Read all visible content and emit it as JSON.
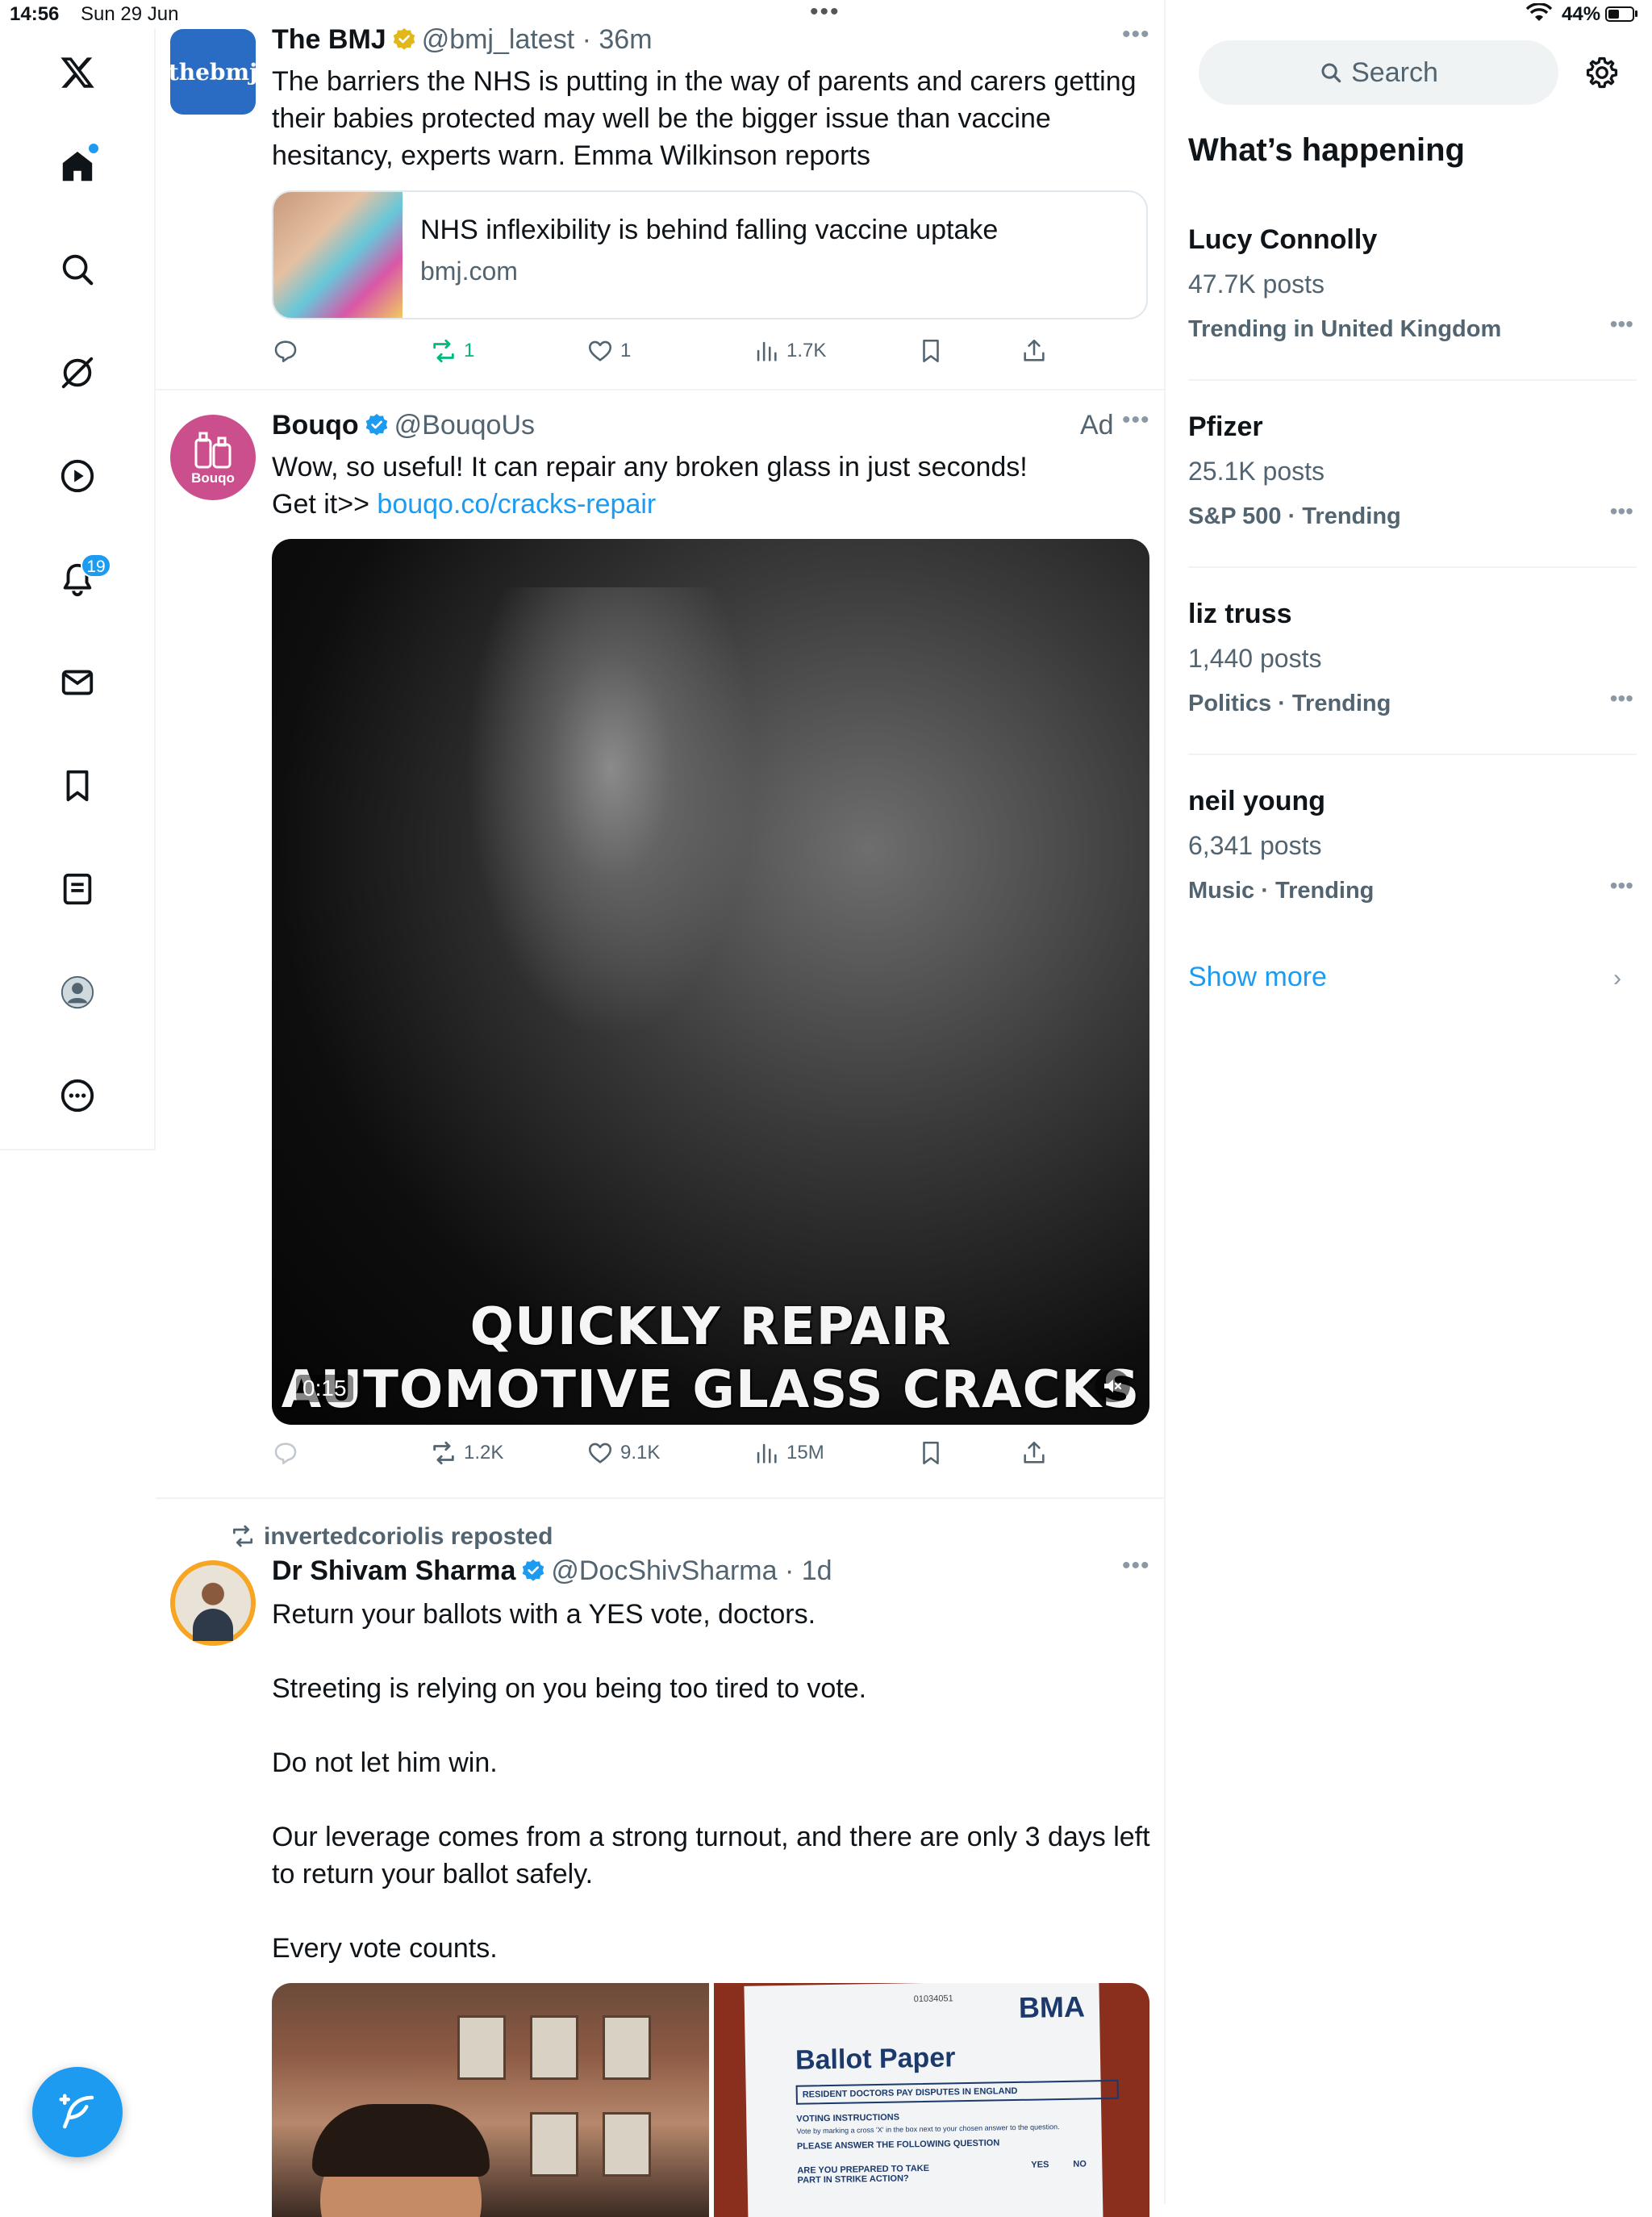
{
  "status_bar": {
    "time": "14:56",
    "date": "Sun 29 Jun",
    "battery": "44%"
  },
  "nav": {
    "items": [
      "logo",
      "home",
      "explore",
      "grok",
      "video",
      "notifications",
      "messages",
      "bookmarks",
      "lists",
      "profile",
      "more"
    ],
    "notifications_badge": "19"
  },
  "tweets": [
    {
      "name": "The BMJ",
      "handle": "@bmj_latest",
      "time": "36m",
      "avatar_text": "thebmj",
      "text_lines": [
        "The barriers the NHS is putting in the way of parents and carers getting",
        "their babies protected may well be the bigger issue than vaccine",
        "hesitancy, experts warn. Emma Wilkinson reports"
      ],
      "card": {
        "title": "NHS inflexibility is behind falling vaccine uptake",
        "domain": "bmj.com"
      },
      "actions": {
        "replies": "",
        "reposts": "1",
        "likes": "1",
        "views": "1.7K"
      }
    },
    {
      "name": "Bouqo",
      "handle": "@BouqoUs",
      "ad_label": "Ad",
      "avatar_text": "Bouqo",
      "text_line1": "Wow, so useful! It can repair any broken glass in just seconds!",
      "text_line2_prefix": "Get it>> ",
      "text_link": "bouqo.co/cracks-repair",
      "video": {
        "caption_line1": "QUICKLY REPAIR",
        "caption_line2": "AUTOMOTIVE GLASS CRACKS",
        "duration": "0:15"
      },
      "actions": {
        "replies": "",
        "reposts": "1.2K",
        "likes": "9.1K",
        "views": "15M"
      }
    },
    {
      "repost_label": "invertedcoriolis reposted",
      "name": "Dr Shivam Sharma",
      "handle": "@DocShivSharma",
      "time": "1d",
      "paragraphs": [
        "Return your ballots with a YES vote, doctors.",
        "Streeting is relying on you being too tired to vote.",
        "Do not let him win.",
        "Our leverage comes from a strong turnout, and there are only 3 days left",
        "to return your ballot safely.",
        "Every vote counts."
      ],
      "ballot_image": {
        "org": "BMA",
        "title": "Ballot Paper",
        "number": "01034051",
        "heading": "RESIDENT DOCTORS PAY DISPUTES IN ENGLAND",
        "voting_instructions": "VOTING INSTRUCTIONS",
        "instruction_detail": "Vote by marking a cross 'X' in the box next to your chosen answer to the question.",
        "please_answer": "PLEASE ANSWER THE FOLLOWING QUESTION",
        "question": "ARE YOU PREPARED TO TAKE PART IN STRIKE ACTION?",
        "yes": "YES",
        "no": "NO"
      }
    }
  ],
  "sidebar": {
    "search_placeholder": "Search",
    "section_title": "What’s happening",
    "trends": [
      {
        "name": "Lucy Connolly",
        "count": "47.7K posts",
        "context": "Trending in United Kingdom"
      },
      {
        "name": "Pfizer",
        "count": "25.1K posts",
        "context": "S&P 500 · Trending"
      },
      {
        "name": "liz truss",
        "count": "1,440 posts",
        "context": "Politics · Trending"
      },
      {
        "name": "neil young",
        "count": "6,341 posts",
        "context": "Music · Trending"
      }
    ],
    "show_more": "Show more"
  },
  "colors": {
    "accent": "#1d9bf0",
    "repost_green": "#00ba7c",
    "verified_gold": "#e2b719",
    "text": "#0f1419",
    "secondary": "#536471"
  }
}
